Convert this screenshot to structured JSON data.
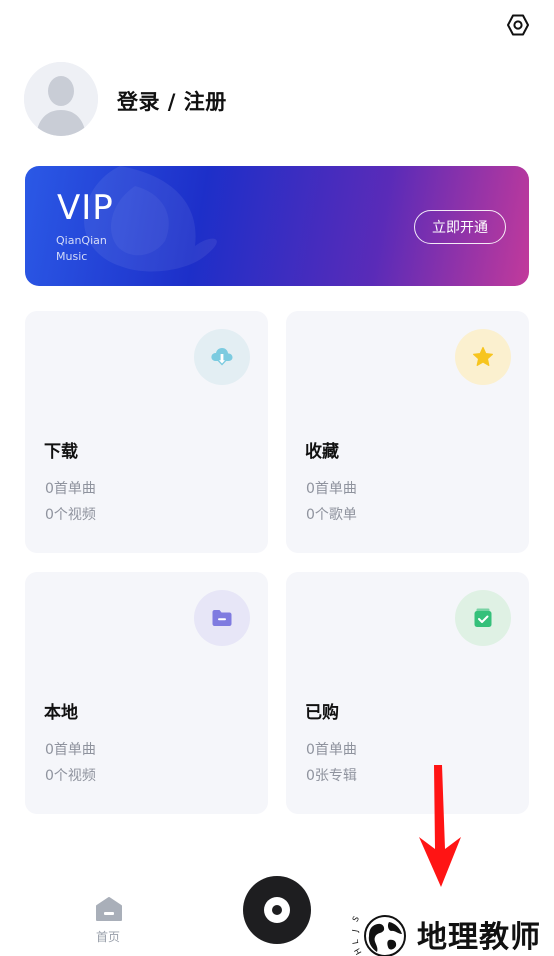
{
  "header": {
    "settings_icon": "gear-icon",
    "login_label": "登录 / 注册"
  },
  "vip": {
    "title": "VIP",
    "subtitle": "QianQian\nMusic",
    "button_label": "立即开通",
    "gradient": [
      "#2b59e6",
      "#1d2fc9",
      "#5a2bb8",
      "#c23a9b"
    ]
  },
  "cards": [
    {
      "title": "下载",
      "line1": "0首单曲",
      "line2": "0个视频",
      "icon": "cloud-download-icon",
      "icon_bg": "#e3eef3",
      "icon_color": "#7ccbe0"
    },
    {
      "title": "收藏",
      "line1": "0首单曲",
      "line2": "0个歌单",
      "icon": "star-icon",
      "icon_bg": "#fbf0cf",
      "icon_color": "#f7c51f"
    },
    {
      "title": "本地",
      "line1": "0首单曲",
      "line2": "0个视频",
      "icon": "folder-icon",
      "icon_bg": "#e7e6f7",
      "icon_color": "#7f7be0"
    },
    {
      "title": "已购",
      "line1": "0首单曲",
      "line2": "0张专辑",
      "icon": "shopping-bag-icon",
      "icon_bg": "#dff1e4",
      "icon_color": "#35c07a"
    }
  ],
  "tabbar": {
    "home_label": "首页"
  },
  "watermark": {
    "text": "地理教师",
    "logo_letters": "SJLH"
  }
}
